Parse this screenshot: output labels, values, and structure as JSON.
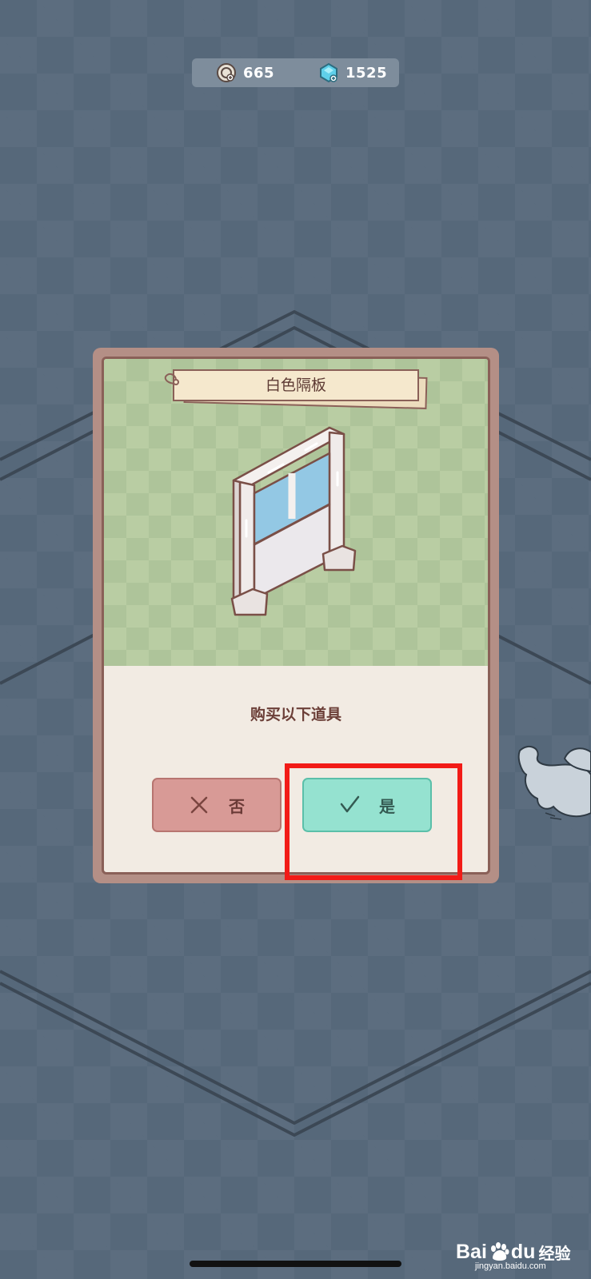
{
  "currency": {
    "coins": "665",
    "coin_icon": "coin-icon",
    "gems": "1525",
    "gem_icon": "gem-icon"
  },
  "dialog": {
    "item_name": "白色隔板",
    "prompt": "购买以下道具",
    "no_label": "否",
    "yes_label": "是"
  },
  "watermark": {
    "bai": "Bai",
    "du": "du",
    "jingyan": "经验",
    "url": "jingyan.baidu.com"
  },
  "colors": {
    "background": "#56687a",
    "dialog_frame": "#b48f86",
    "preview_green": "#b9cda3",
    "no_button": "#d89a96",
    "yes_button": "#95e2d0",
    "highlight": "#f21b17"
  }
}
